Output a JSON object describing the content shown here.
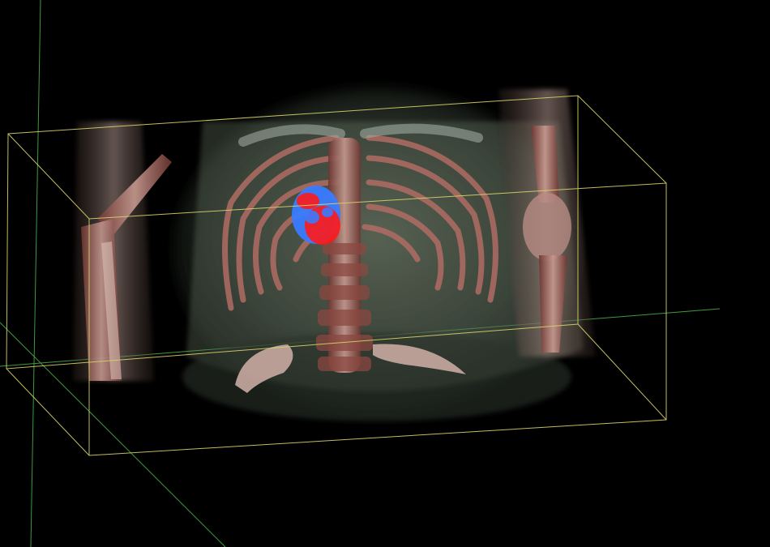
{
  "viewer": {
    "background_color": "#000000",
    "bounding_box_color": "#d6d36a",
    "axis_color": "#3f9a3f",
    "segmentation_colors": [
      "#ff1a1a",
      "#3a7bff"
    ],
    "bone_color": "#a4605a",
    "soft_tissue_color": "#8e9c86"
  }
}
